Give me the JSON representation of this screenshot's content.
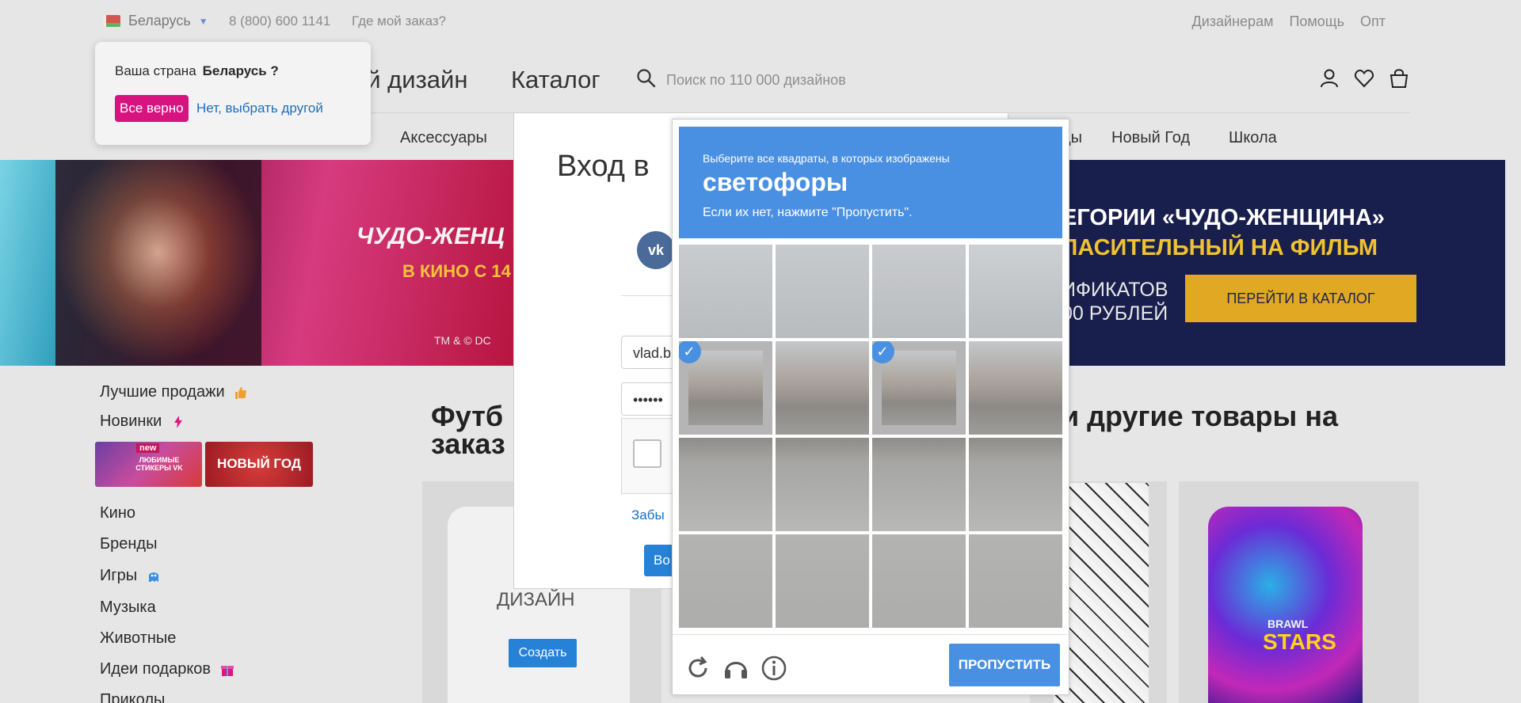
{
  "topbar": {
    "country": "Беларусь",
    "phone": "8 (800) 600 1141",
    "order": "Где мой заказ?",
    "links": [
      "Дизайнерам",
      "Помощь",
      "Опт"
    ]
  },
  "country_popup": {
    "question": "Ваша страна",
    "country": "Беларусь ?",
    "yes": "Все верно",
    "no": "Нет, выбрать другой"
  },
  "header": {
    "logo_text": "ой дизайн",
    "catalog": "Каталог",
    "search_placeholder": "Поиск по 110 000 дизайнов"
  },
  "nav": {
    "accessories": "Аксессуары",
    "cut": "ды",
    "new_year": "Новый Год",
    "school": "Школа"
  },
  "banner": {
    "left_title": "ЧУДО-ЖЕНЦ",
    "left_sub": "В КИНО С 14",
    "left_copy": "TM & © DC",
    "right_l1": "ЕГОРИИ «ЧУДО-ЖЕНЩИНА»",
    "right_l2": "ЛАСИТЕЛЬНЫЙ НА ФИЛЬМ",
    "right_l3": "ИФИКАТОВ",
    "right_l4": "00 РУБЛЕЙ",
    "cta": "ПЕРЕЙТИ В КАТАЛОГ"
  },
  "sidebar": {
    "best": "Лучшие продажи",
    "new": "Новинки",
    "tile1_badge": "new",
    "tile1_text": "ЛЮБИМЫЕ СТИКЕРЫ VK",
    "tile2_text": "НОВЫЙ ГОД",
    "items": [
      "Кино",
      "Бренды",
      "Игры",
      "Музыка",
      "Животные",
      "Идеи подарков",
      "Приколы"
    ]
  },
  "main": {
    "title1": "Футб",
    "title2": "заказ",
    "title3": "и другие товары на",
    "design_text": "ДИЗАЙН",
    "create_btn": "Создать",
    "brawl": "BRAWL",
    "stars": "STARS"
  },
  "login": {
    "title": "Вход в",
    "vk": "vk",
    "email": "vlad.b",
    "password": "••••••",
    "forgot": "Забы",
    "submit": "Во"
  },
  "captcha": {
    "line1": "Выберите все квадраты, в которых изображены",
    "line2": "светофоры",
    "line3": "Если их нет, нажмите \"Пропустить\".",
    "skip": "ПРОПУСТИТЬ",
    "selected_cells": [
      4,
      6
    ],
    "icons": [
      "reload-icon",
      "audio-icon",
      "info-icon"
    ]
  },
  "colors": {
    "accent_pink": "#d6137f",
    "captcha_blue": "#4a90e2",
    "link_blue": "#1b6fbf",
    "button_blue": "#2582d6",
    "cta_gold": "#e0a823"
  }
}
